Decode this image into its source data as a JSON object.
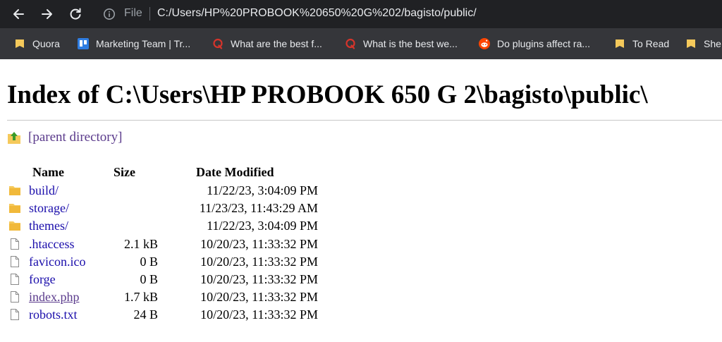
{
  "browser": {
    "address": {
      "scheme_label": "File",
      "url": "C:/Users/HP%20PROBOOK%20650%20G%202/bagisto/public/"
    },
    "bookmarks": [
      {
        "label": "Quora",
        "icon": "folder-icon"
      },
      {
        "label": "Marketing Team | Tr...",
        "icon": "trello-icon"
      },
      {
        "label": "What are the best f...",
        "icon": "quora-icon"
      },
      {
        "label": "What is the best we...",
        "icon": "quora-icon"
      },
      {
        "label": "Do plugins affect ra...",
        "icon": "reddit-icon"
      },
      {
        "label": "To Read",
        "icon": "folder-icon"
      },
      {
        "label": "She",
        "icon": "folder-icon"
      }
    ]
  },
  "page": {
    "title": "Index of C:\\Users\\HP PROBOOK 650 G 2\\bagisto\\public\\",
    "parent_link": "[parent directory]",
    "headers": {
      "name": "Name",
      "size": "Size",
      "date": "Date Modified"
    },
    "files": [
      {
        "name": "build/",
        "size": "",
        "date": "11/22/23, 3:04:09 PM",
        "type": "folder"
      },
      {
        "name": "storage/",
        "size": "",
        "date": "11/23/23, 11:43:29 AM",
        "type": "folder"
      },
      {
        "name": "themes/",
        "size": "",
        "date": "11/22/23, 3:04:09 PM",
        "type": "folder"
      },
      {
        "name": ".htaccess",
        "size": "2.1 kB",
        "date": "10/20/23, 11:33:32 PM",
        "type": "file"
      },
      {
        "name": "favicon.ico",
        "size": "0 B",
        "date": "10/20/23, 11:33:32 PM",
        "type": "file"
      },
      {
        "name": "forge",
        "size": "0 B",
        "date": "10/20/23, 11:33:32 PM",
        "type": "file"
      },
      {
        "name": "index.php",
        "size": "1.7 kB",
        "date": "10/20/23, 11:33:32 PM",
        "type": "file",
        "visited": true
      },
      {
        "name": "robots.txt",
        "size": "24 B",
        "date": "10/20/23, 11:33:32 PM",
        "type": "file"
      }
    ]
  },
  "colors": {
    "toolbar_bg": "#202124",
    "bookmarks_bg": "#35363a",
    "link": "#1a0dab",
    "visited_link": "#5b3b8c",
    "folder": "#f5c95b"
  }
}
